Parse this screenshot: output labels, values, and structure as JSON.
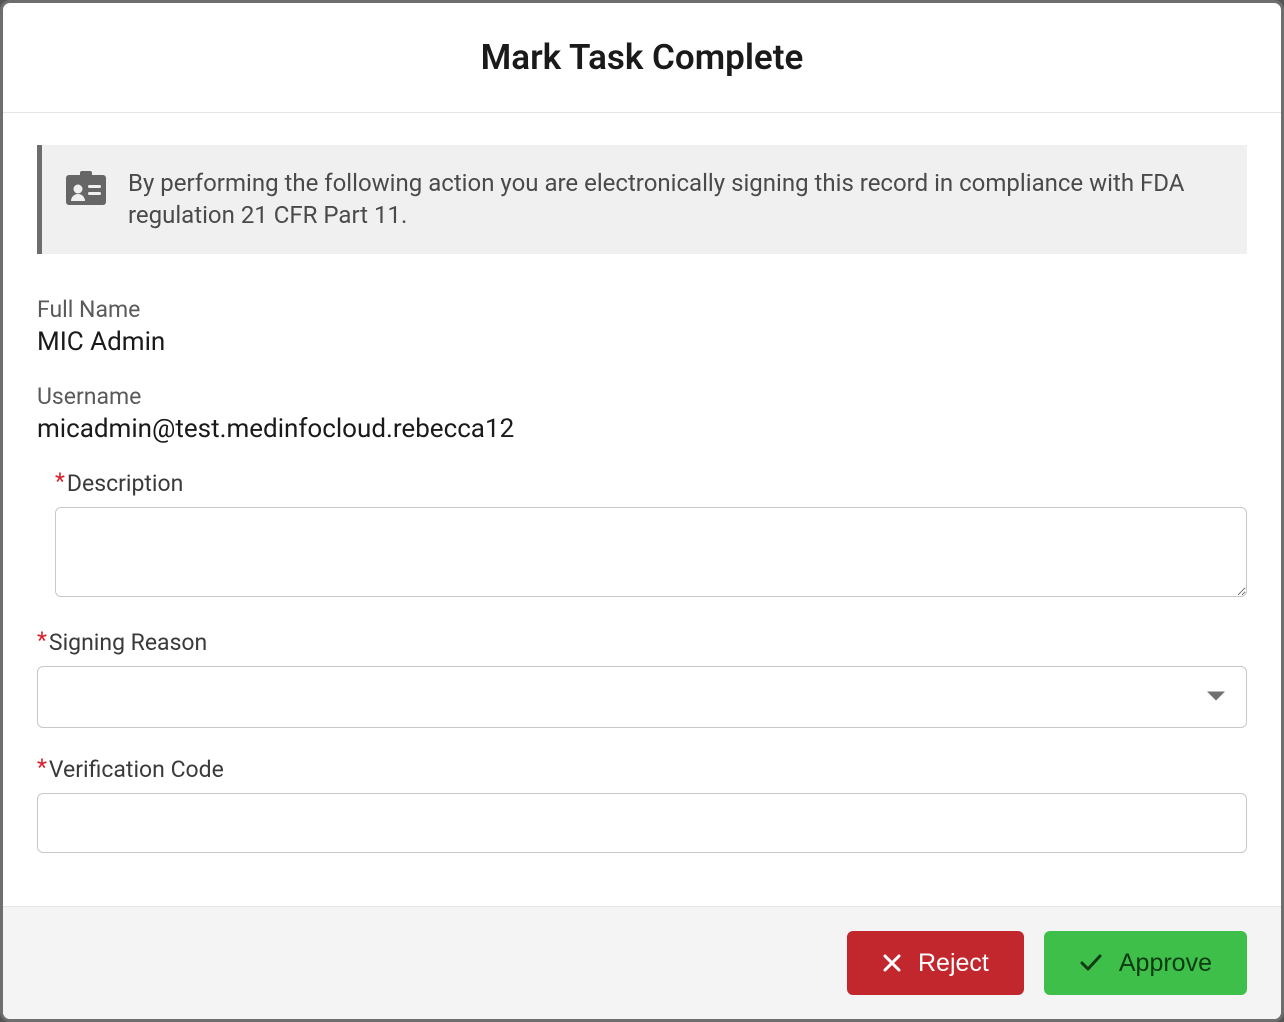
{
  "header": {
    "title": "Mark Task Complete"
  },
  "notice": {
    "text": "By performing the following action you are electronically signing this record in compliance with FDA regulation 21 CFR Part 11."
  },
  "identity": {
    "full_name_label": "Full Name",
    "full_name_value": "MIC Admin",
    "username_label": "Username",
    "username_value": "micadmin@test.medinfocloud.rebecca12"
  },
  "fields": {
    "description": {
      "label": "Description",
      "value": ""
    },
    "signing_reason": {
      "label": "Signing Reason",
      "selected": ""
    },
    "verification_code": {
      "label": "Verification Code",
      "value": ""
    }
  },
  "footer": {
    "reject_label": "Reject",
    "approve_label": "Approve"
  }
}
